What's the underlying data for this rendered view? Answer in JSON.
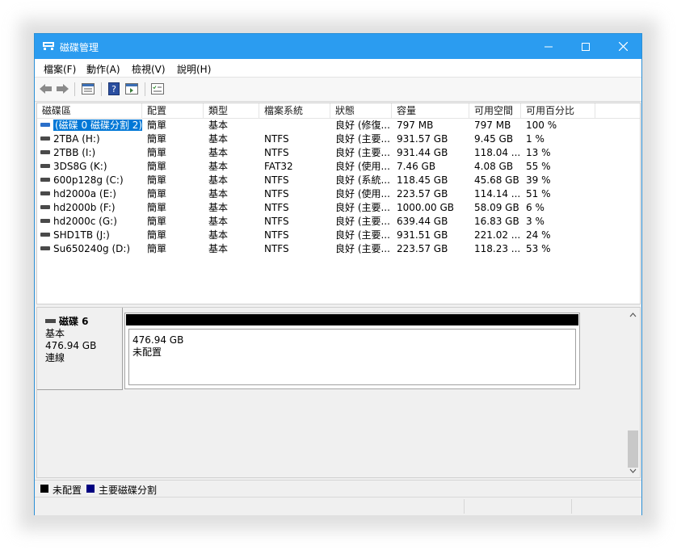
{
  "window": {
    "title": "磁碟管理",
    "accent": "#2b9cf0"
  },
  "menu": [
    "檔案(F)",
    "動作(A)",
    "檢視(V)",
    "說明(H)"
  ],
  "toolbar": [
    "back-icon",
    "forward-icon",
    "disk-list-icon",
    "help-icon",
    "properties-icon",
    "checklist-icon"
  ],
  "columns": [
    "磁碟區",
    "配置",
    "類型",
    "檔案系統",
    "狀態",
    "容量",
    "可用空間",
    "可用百分比"
  ],
  "volumes": [
    {
      "name": "(磁碟 0 磁碟分割 2)",
      "layout": "簡單",
      "type": "基本",
      "fs": "",
      "status": "良好 (修復...",
      "capacity": "797 MB",
      "free": "797 MB",
      "pct": "100 %",
      "selected": true
    },
    {
      "name": "2TBA (H:)",
      "layout": "簡單",
      "type": "基本",
      "fs": "NTFS",
      "status": "良好 (主要...",
      "capacity": "931.57 GB",
      "free": "9.45 GB",
      "pct": "1 %"
    },
    {
      "name": "2TBB (I:)",
      "layout": "簡單",
      "type": "基本",
      "fs": "NTFS",
      "status": "良好 (主要...",
      "capacity": "931.44 GB",
      "free": "118.04 ...",
      "pct": "13 %"
    },
    {
      "name": "3DS8G (K:)",
      "layout": "簡單",
      "type": "基本",
      "fs": "FAT32",
      "status": "良好 (使用...",
      "capacity": "7.46 GB",
      "free": "4.08 GB",
      "pct": "55 %"
    },
    {
      "name": "600p128g (C:)",
      "layout": "簡單",
      "type": "基本",
      "fs": "NTFS",
      "status": "良好 (系統...",
      "capacity": "118.45 GB",
      "free": "45.68 GB",
      "pct": "39 %"
    },
    {
      "name": "hd2000a (E:)",
      "layout": "簡單",
      "type": "基本",
      "fs": "NTFS",
      "status": "良好 (使用...",
      "capacity": "223.57 GB",
      "free": "114.14 ...",
      "pct": "51 %"
    },
    {
      "name": "hd2000b (F:)",
      "layout": "簡單",
      "type": "基本",
      "fs": "NTFS",
      "status": "良好 (主要...",
      "capacity": "1000.00 GB",
      "free": "58.09 GB",
      "pct": "6 %"
    },
    {
      "name": "hd2000c (G:)",
      "layout": "簡單",
      "type": "基本",
      "fs": "NTFS",
      "status": "良好 (主要...",
      "capacity": "639.44 GB",
      "free": "16.83 GB",
      "pct": "3 %"
    },
    {
      "name": "SHD1TB (J:)",
      "layout": "簡單",
      "type": "基本",
      "fs": "NTFS",
      "status": "良好 (主要...",
      "capacity": "931.51 GB",
      "free": "221.02 ...",
      "pct": "24 %"
    },
    {
      "name": "Su650240g (D:)",
      "layout": "簡單",
      "type": "基本",
      "fs": "NTFS",
      "status": "良好 (主要...",
      "capacity": "223.57 GB",
      "free": "118.23 ...",
      "pct": "53 %"
    }
  ],
  "disk": {
    "name": "磁碟 6",
    "type": "基本",
    "size": "476.94 GB",
    "state": "連線"
  },
  "partition": {
    "size": "476.94 GB",
    "label": "未配置",
    "color": "#000000"
  },
  "legend": [
    {
      "label": "未配置",
      "color": "#000000"
    },
    {
      "label": "主要磁碟分割",
      "color": "#000080"
    }
  ]
}
